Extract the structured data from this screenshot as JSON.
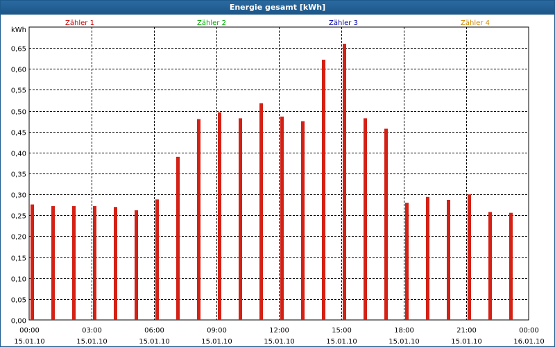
{
  "window": {
    "title": "Energie gesamt [kWh]"
  },
  "colors": {
    "bar": "#d42015",
    "grid": "#000000",
    "titlebar": "#1c5a8c"
  },
  "chart_data": {
    "type": "bar",
    "title": "Energie gesamt [kWh]",
    "ylabel": "kWh",
    "ylim": [
      0,
      0.7
    ],
    "y_ticks": [
      "0,00",
      "0,05",
      "0,10",
      "0,15",
      "0,20",
      "0,25",
      "0,30",
      "0,35",
      "0,40",
      "0,45",
      "0,50",
      "0,55",
      "0,60",
      "0,65"
    ],
    "x_ticks": [
      {
        "time": "00:00",
        "date": "15.01.10"
      },
      {
        "time": "03:00",
        "date": "15.01.10"
      },
      {
        "time": "06:00",
        "date": "15.01.10"
      },
      {
        "time": "09:00",
        "date": "15.01.10"
      },
      {
        "time": "12:00",
        "date": "15.01.10"
      },
      {
        "time": "15:00",
        "date": "15.01.10"
      },
      {
        "time": "18:00",
        "date": "15.01.10"
      },
      {
        "time": "21:00",
        "date": "15.01.10"
      },
      {
        "time": "00:00",
        "date": "16.01.10"
      }
    ],
    "legend": [
      {
        "name": "Zähler 1",
        "color": "#cc0000"
      },
      {
        "name": "Zähler 2",
        "color": "#00aa00"
      },
      {
        "name": "Zähler 3",
        "color": "#0000aa"
      },
      {
        "name": "Zähler 4",
        "color": "#cc8800"
      }
    ],
    "legend_position": "top",
    "grid": true,
    "hours": [
      0,
      1,
      2,
      3,
      4,
      5,
      6,
      7,
      8,
      9,
      10,
      11,
      12,
      13,
      14,
      15,
      16,
      17,
      18,
      19,
      20,
      21,
      22,
      23
    ],
    "values": [
      0.276,
      0.272,
      0.272,
      0.272,
      0.27,
      0.262,
      0.288,
      0.39,
      0.48,
      0.496,
      0.482,
      0.518,
      0.486,
      0.475,
      0.622,
      0.66,
      0.482,
      0.457,
      0.28,
      0.294,
      0.287,
      0.3,
      0.258,
      0.256
    ]
  }
}
